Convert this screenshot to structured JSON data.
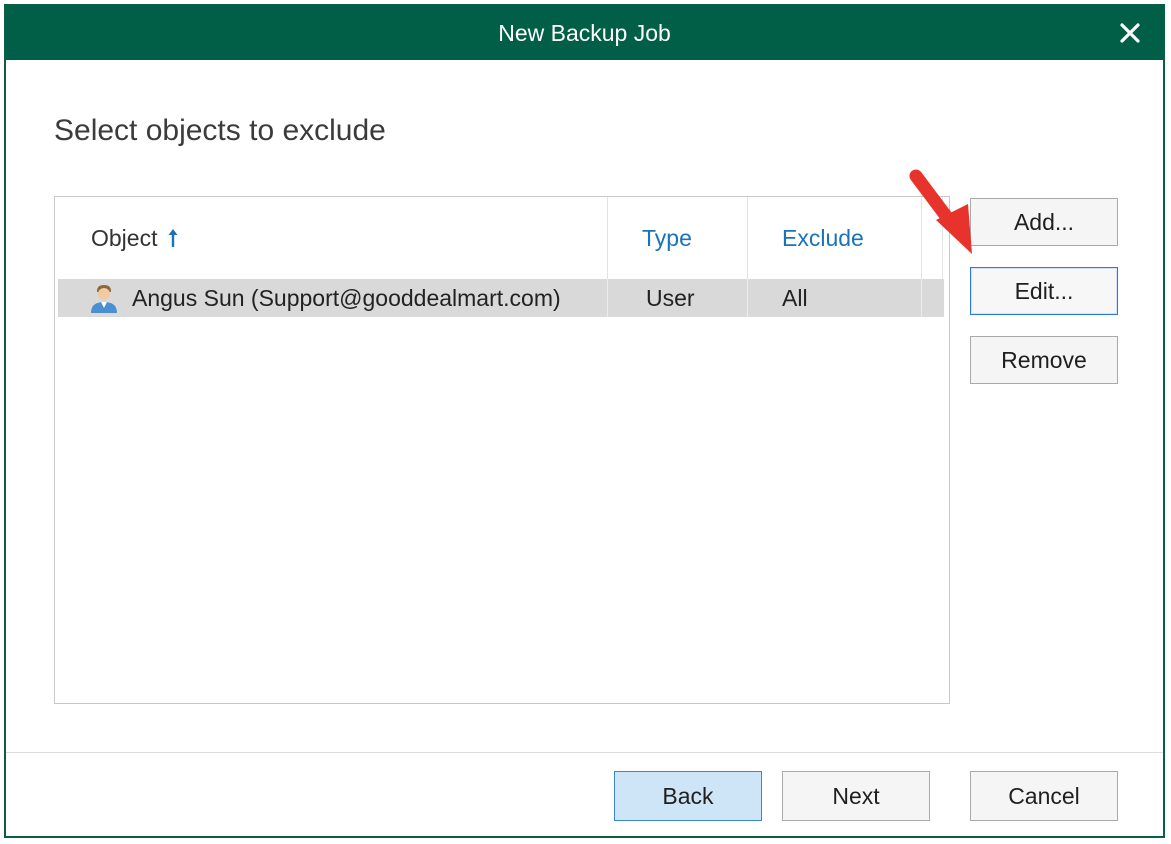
{
  "window": {
    "title": "New Backup Job"
  },
  "page": {
    "heading": "Select objects to exclude"
  },
  "table": {
    "columns": {
      "object": "Object",
      "type": "Type",
      "exclude": "Exclude"
    },
    "rows": [
      {
        "object": "Angus Sun (Support@gooddealmart.com)",
        "type": "User",
        "exclude": "All",
        "icon": "user-icon"
      }
    ]
  },
  "side_buttons": {
    "add": "Add...",
    "edit": "Edit...",
    "remove": "Remove"
  },
  "footer_buttons": {
    "back": "Back",
    "next": "Next",
    "cancel": "Cancel"
  },
  "colors": {
    "titlebar": "#005f46",
    "accent": "#1a73b8",
    "annotation_arrow": "#e8322c"
  },
  "icons": [
    "close-icon",
    "sort-ascending-icon",
    "user-icon",
    "annotation-arrow-icon"
  ]
}
